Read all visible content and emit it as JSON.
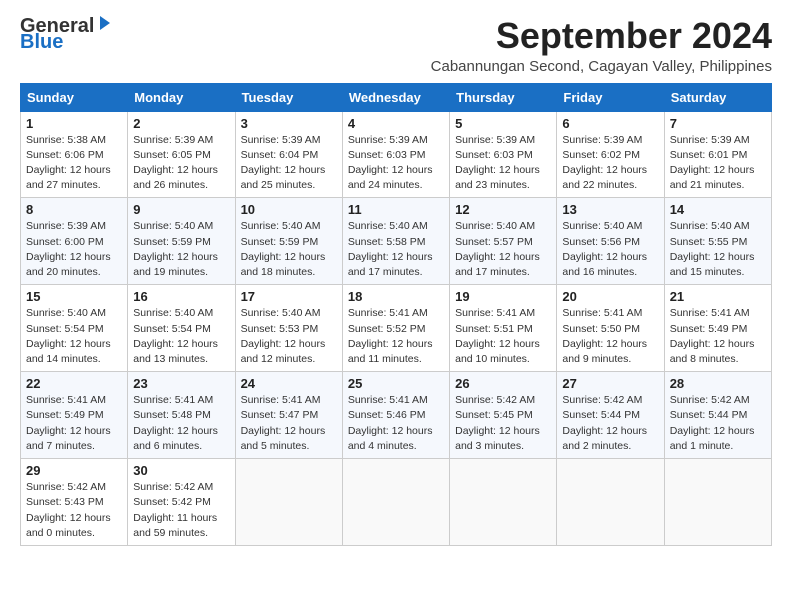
{
  "header": {
    "logo_general": "General",
    "logo_blue": "Blue",
    "month_title": "September 2024",
    "subtitle": "Cabannungan Second, Cagayan Valley, Philippines"
  },
  "weekdays": [
    "Sunday",
    "Monday",
    "Tuesday",
    "Wednesday",
    "Thursday",
    "Friday",
    "Saturday"
  ],
  "weeks": [
    [
      {
        "day": "1",
        "info": "Sunrise: 5:38 AM\nSunset: 6:06 PM\nDaylight: 12 hours\nand 27 minutes."
      },
      {
        "day": "2",
        "info": "Sunrise: 5:39 AM\nSunset: 6:05 PM\nDaylight: 12 hours\nand 26 minutes."
      },
      {
        "day": "3",
        "info": "Sunrise: 5:39 AM\nSunset: 6:04 PM\nDaylight: 12 hours\nand 25 minutes."
      },
      {
        "day": "4",
        "info": "Sunrise: 5:39 AM\nSunset: 6:03 PM\nDaylight: 12 hours\nand 24 minutes."
      },
      {
        "day": "5",
        "info": "Sunrise: 5:39 AM\nSunset: 6:03 PM\nDaylight: 12 hours\nand 23 minutes."
      },
      {
        "day": "6",
        "info": "Sunrise: 5:39 AM\nSunset: 6:02 PM\nDaylight: 12 hours\nand 22 minutes."
      },
      {
        "day": "7",
        "info": "Sunrise: 5:39 AM\nSunset: 6:01 PM\nDaylight: 12 hours\nand 21 minutes."
      }
    ],
    [
      {
        "day": "8",
        "info": "Sunrise: 5:39 AM\nSunset: 6:00 PM\nDaylight: 12 hours\nand 20 minutes."
      },
      {
        "day": "9",
        "info": "Sunrise: 5:40 AM\nSunset: 5:59 PM\nDaylight: 12 hours\nand 19 minutes."
      },
      {
        "day": "10",
        "info": "Sunrise: 5:40 AM\nSunset: 5:59 PM\nDaylight: 12 hours\nand 18 minutes."
      },
      {
        "day": "11",
        "info": "Sunrise: 5:40 AM\nSunset: 5:58 PM\nDaylight: 12 hours\nand 17 minutes."
      },
      {
        "day": "12",
        "info": "Sunrise: 5:40 AM\nSunset: 5:57 PM\nDaylight: 12 hours\nand 17 minutes."
      },
      {
        "day": "13",
        "info": "Sunrise: 5:40 AM\nSunset: 5:56 PM\nDaylight: 12 hours\nand 16 minutes."
      },
      {
        "day": "14",
        "info": "Sunrise: 5:40 AM\nSunset: 5:55 PM\nDaylight: 12 hours\nand 15 minutes."
      }
    ],
    [
      {
        "day": "15",
        "info": "Sunrise: 5:40 AM\nSunset: 5:54 PM\nDaylight: 12 hours\nand 14 minutes."
      },
      {
        "day": "16",
        "info": "Sunrise: 5:40 AM\nSunset: 5:54 PM\nDaylight: 12 hours\nand 13 minutes."
      },
      {
        "day": "17",
        "info": "Sunrise: 5:40 AM\nSunset: 5:53 PM\nDaylight: 12 hours\nand 12 minutes."
      },
      {
        "day": "18",
        "info": "Sunrise: 5:41 AM\nSunset: 5:52 PM\nDaylight: 12 hours\nand 11 minutes."
      },
      {
        "day": "19",
        "info": "Sunrise: 5:41 AM\nSunset: 5:51 PM\nDaylight: 12 hours\nand 10 minutes."
      },
      {
        "day": "20",
        "info": "Sunrise: 5:41 AM\nSunset: 5:50 PM\nDaylight: 12 hours\nand 9 minutes."
      },
      {
        "day": "21",
        "info": "Sunrise: 5:41 AM\nSunset: 5:49 PM\nDaylight: 12 hours\nand 8 minutes."
      }
    ],
    [
      {
        "day": "22",
        "info": "Sunrise: 5:41 AM\nSunset: 5:49 PM\nDaylight: 12 hours\nand 7 minutes."
      },
      {
        "day": "23",
        "info": "Sunrise: 5:41 AM\nSunset: 5:48 PM\nDaylight: 12 hours\nand 6 minutes."
      },
      {
        "day": "24",
        "info": "Sunrise: 5:41 AM\nSunset: 5:47 PM\nDaylight: 12 hours\nand 5 minutes."
      },
      {
        "day": "25",
        "info": "Sunrise: 5:41 AM\nSunset: 5:46 PM\nDaylight: 12 hours\nand 4 minutes."
      },
      {
        "day": "26",
        "info": "Sunrise: 5:42 AM\nSunset: 5:45 PM\nDaylight: 12 hours\nand 3 minutes."
      },
      {
        "day": "27",
        "info": "Sunrise: 5:42 AM\nSunset: 5:44 PM\nDaylight: 12 hours\nand 2 minutes."
      },
      {
        "day": "28",
        "info": "Sunrise: 5:42 AM\nSunset: 5:44 PM\nDaylight: 12 hours\nand 1 minute."
      }
    ],
    [
      {
        "day": "29",
        "info": "Sunrise: 5:42 AM\nSunset: 5:43 PM\nDaylight: 12 hours\nand 0 minutes."
      },
      {
        "day": "30",
        "info": "Sunrise: 5:42 AM\nSunset: 5:42 PM\nDaylight: 11 hours\nand 59 minutes."
      },
      {
        "day": "",
        "info": ""
      },
      {
        "day": "",
        "info": ""
      },
      {
        "day": "",
        "info": ""
      },
      {
        "day": "",
        "info": ""
      },
      {
        "day": "",
        "info": ""
      }
    ]
  ]
}
